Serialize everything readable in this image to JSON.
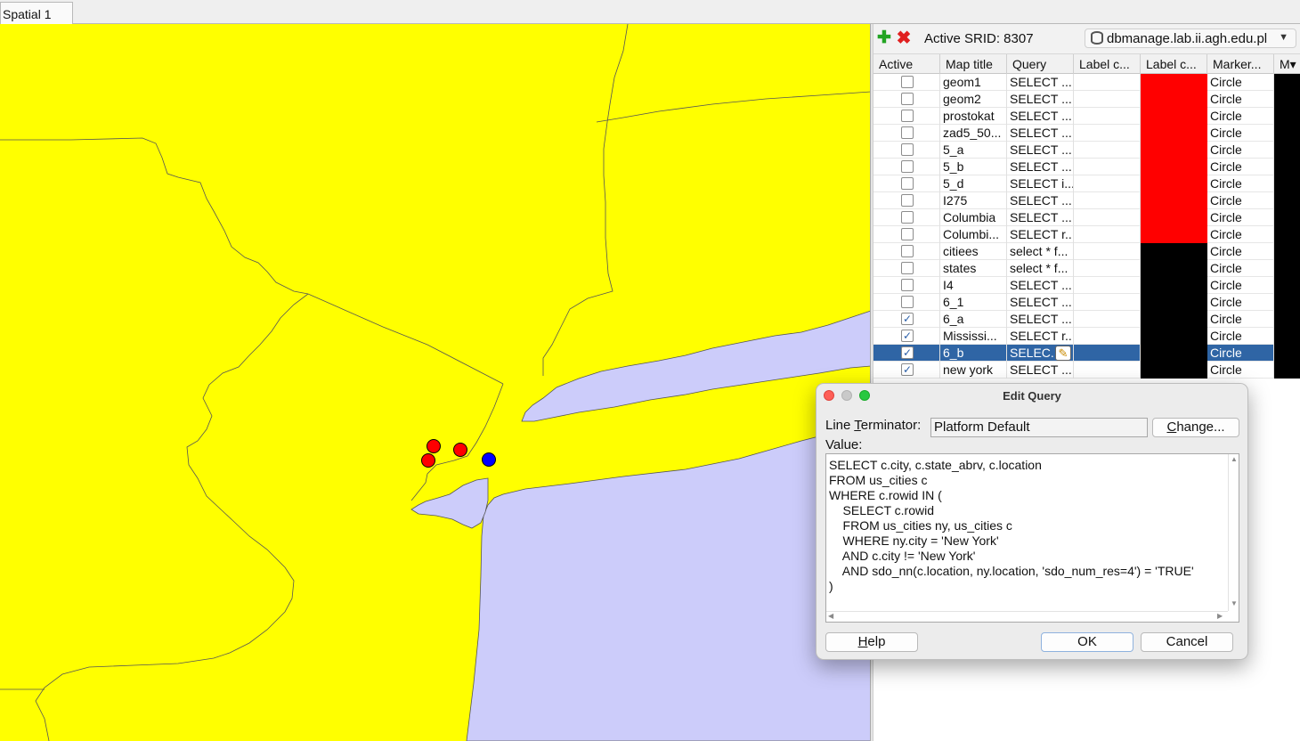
{
  "tab": {
    "label": "Spatial 1"
  },
  "colors": {
    "land": "#ffff00",
    "water": "#ccccfa",
    "red_marker": "#ff0000",
    "blue_marker": "#0000ff",
    "selection": "#2f65a5"
  },
  "toolbar": {
    "add_icon": "plus-icon",
    "delete_icon": "delete-icon",
    "active_srid": "Active SRID: 8307",
    "connection": "dbmanage.lab.ii.agh.edu.pl"
  },
  "table": {
    "columns": [
      "Active",
      "Map title",
      "Query",
      "Label c...",
      "Label c...",
      "Marker...",
      "M"
    ],
    "rows": [
      {
        "active": false,
        "title": "geom1",
        "query": "SELECT ...",
        "label_color": "#ff0000",
        "marker": "Circle"
      },
      {
        "active": false,
        "title": "geom2",
        "query": "SELECT ...",
        "label_color": "#ff0000",
        "marker": "Circle"
      },
      {
        "active": false,
        "title": "prostokat",
        "query": "SELECT  ...",
        "label_color": "#ff0000",
        "marker": "Circle"
      },
      {
        "active": false,
        "title": "zad5_50...",
        "query": "SELECT ...",
        "label_color": "#ff0000",
        "marker": "Circle"
      },
      {
        "active": false,
        "title": "5_a",
        "query": "SELECT ...",
        "label_color": "#ff0000",
        "marker": "Circle"
      },
      {
        "active": false,
        "title": "5_b",
        "query": "SELECT ...",
        "label_color": "#ff0000",
        "marker": "Circle"
      },
      {
        "active": false,
        "title": "5_d",
        "query": "SELECT i...",
        "label_color": "#ff0000",
        "marker": "Circle"
      },
      {
        "active": false,
        "title": "I275",
        "query": "SELECT ...",
        "label_color": "#ff0000",
        "marker": "Circle"
      },
      {
        "active": false,
        "title": "Columbia",
        "query": "SELECT ...",
        "label_color": "#ff0000",
        "marker": "Circle"
      },
      {
        "active": false,
        "title": "Columbi...",
        "query": "SELECT r...",
        "label_color": "#ff0000",
        "marker": "Circle"
      },
      {
        "active": false,
        "title": "citiees",
        "query": "select * f...",
        "label_color": "#000000",
        "marker": "Circle"
      },
      {
        "active": false,
        "title": "states",
        "query": "select * f...",
        "label_color": "#000000",
        "marker": "Circle"
      },
      {
        "active": false,
        "title": "I4",
        "query": "SELECT ...",
        "label_color": "#000000",
        "marker": "Circle"
      },
      {
        "active": false,
        "title": "6_1",
        "query": "SELECT ...",
        "label_color": "#000000",
        "marker": "Circle"
      },
      {
        "active": true,
        "title": "6_a",
        "query": "SELECT ...",
        "label_color": "#000000",
        "marker": "Circle"
      },
      {
        "active": true,
        "title": "Mississi...",
        "query": "SELECT r...",
        "label_color": "#000000",
        "marker": "Circle"
      },
      {
        "active": true,
        "title": "6_b",
        "query": "SELEC...",
        "label_color": "#000000",
        "marker": "Circle",
        "selected": true
      },
      {
        "active": true,
        "title": "new york",
        "query": "SELECT ...",
        "label_color": "#000000",
        "marker": "Circle"
      }
    ]
  },
  "dialog": {
    "title": "Edit Query",
    "line_terminator_label": "Line Terminator:",
    "line_terminator_value": "Platform Default",
    "change_button": "Change...",
    "value_label": "Value:",
    "query_text": "SELECT c.city, c.state_abrv, c.location\nFROM us_cities c\nWHERE c.rowid IN (\n    SELECT c.rowid\n    FROM us_cities ny, us_cities c\n    WHERE ny.city = 'New York'\n    AND c.city != 'New York'\n    AND sdo_nn(c.location, ny.location, 'sdo_num_res=4') = 'TRUE'\n)",
    "help_button": "Help",
    "ok_button": "OK",
    "cancel_button": "Cancel"
  }
}
